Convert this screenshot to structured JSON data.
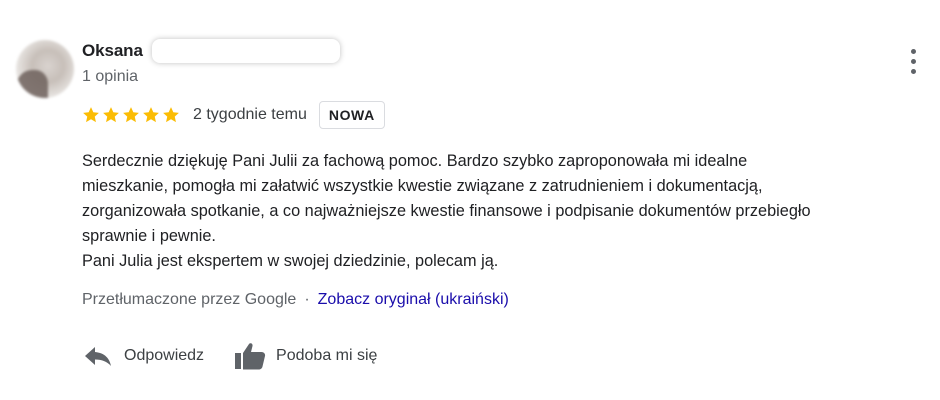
{
  "author": {
    "name": "Oksana",
    "review_count": "1 opinia"
  },
  "review": {
    "rating": 5,
    "rating_max": 5,
    "date": "2 tygodnie temu",
    "badge": "NOWA",
    "text_lines": [
      "Serdecznie dziękuję Pani Julii za fachową pomoc. Bardzo szybko zaproponowała mi idealne",
      "mieszkanie, pomogła mi załatwić wszystkie kwestie związane z zatrudnieniem i dokumentacją,",
      "zorganizowała spotkanie, a co najważniejsze kwestie finansowe i podpisanie dokumentów przebiegło",
      "sprawnie i pewnie.",
      "Pani Julia jest ekspertem w swojej dziedzinie, polecam ją."
    ]
  },
  "translation": {
    "note": "Przetłumaczone przez Google",
    "separator": "·",
    "link": "Zobacz oryginał (ukraiński)"
  },
  "actions": {
    "reply": "Odpowiedz",
    "like": "Podoba mi się"
  },
  "icons": {
    "star": "star-icon",
    "more": "more-vert-icon",
    "reply": "reply-arrow-icon",
    "like": "thumb-up-icon"
  },
  "colors": {
    "star": "#fbbc04",
    "link": "#1a0dab",
    "secondary_text": "#5f6368",
    "icon": "#5f6368"
  }
}
